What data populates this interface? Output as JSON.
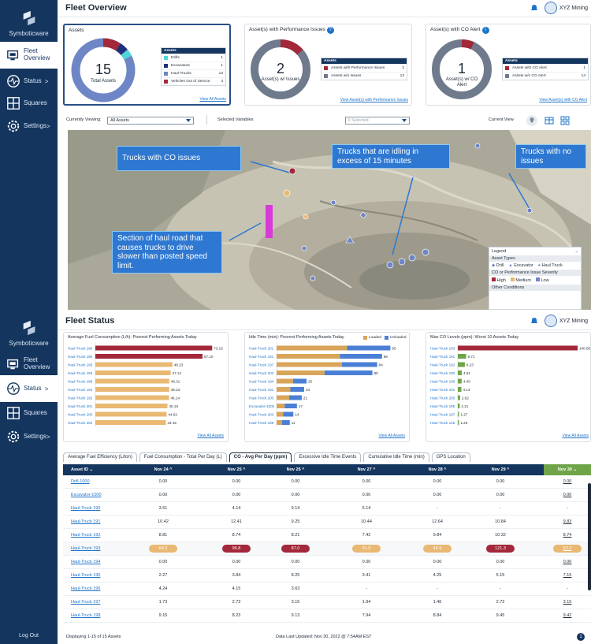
{
  "top": {
    "brand": "Symboticware",
    "page_title": "Fleet Overview",
    "user_name": "XYZ Mining",
    "nav": [
      {
        "label": "Fleet Overview"
      },
      {
        "label": "Status",
        "arrow": ">"
      },
      {
        "label": "Squares"
      },
      {
        "label": "Settings",
        "arrow": ">"
      }
    ],
    "assets_card": {
      "title": "Assets",
      "donut_value": "15",
      "donut_label": "Total Assets",
      "legend_header": "Assets",
      "legend": [
        {
          "label": "Drills",
          "count": "1",
          "color": "#4fd6d6"
        },
        {
          "label": "Excavators",
          "count": "1",
          "color": "#1f2f7a"
        },
        {
          "label": "Haul-Trucks",
          "count": "13",
          "color": "#6f86c6"
        },
        {
          "label": "Vehicles Out of Service",
          "count": "3",
          "color": "#a3283a"
        }
      ],
      "link": "View All Assets"
    },
    "perf_card": {
      "title": "Asset(s) with Performance Issues",
      "donut_value": "2",
      "donut_label": "Asset(s) w/ Issues",
      "legend_header": "Assets",
      "legend": [
        {
          "label": "Assets with Performance Issues",
          "count": "2",
          "color": "#a3283a"
        },
        {
          "label": "Assets w/o Issues",
          "count": "13",
          "color": "#6f7b8c"
        }
      ],
      "link": "View Asset(s) with Performance Issues"
    },
    "co_card": {
      "title": "Asset(s) with CO Alert",
      "donut_value": "1",
      "donut_label": "Asset(s) w/ CO Alert",
      "legend_header": "Assets",
      "legend": [
        {
          "label": "Assets with CO Alert",
          "count": "1",
          "color": "#a3283a"
        },
        {
          "label": "Assets w/o CO Alert",
          "count": "14",
          "color": "#6f7b8c"
        }
      ],
      "link": "View Asset(s) with CO Alert"
    },
    "filters": {
      "viewing_label": "Currently Viewing:",
      "viewing_value": "All Assets",
      "variables_label": "Selected Variables",
      "variables_value": "0 Selected",
      "view_label": "Current View"
    },
    "map": {
      "callouts": [
        "Trucks with CO issues",
        "Trucks that are idling in excess of 15 minutes",
        "Trucks with no issues",
        "Section of haul road that causes trucks to drive slower than posted speed limit."
      ],
      "legend": {
        "title": "Legend",
        "asset_types_label": "Asset Types",
        "types": [
          "Drill",
          "Excavator",
          "Haul Truck"
        ],
        "severity_label": "CO or Performance Issue Severity",
        "severities": [
          {
            "label": "High",
            "color": "#a3283a"
          },
          {
            "label": "Medium",
            "color": "#e9b872"
          },
          {
            "label": "Low",
            "color": "#6f86c6"
          }
        ],
        "other_label": "Other Conditions"
      }
    }
  },
  "bottom": {
    "brand": "Symboticware",
    "page_title": "Fleet Status",
    "user_name": "XYZ Mining",
    "nav": [
      {
        "label": "Fleet Overview"
      },
      {
        "label": "Status",
        "arrow": ">"
      },
      {
        "label": "Squares"
      },
      {
        "label": "Settings",
        "arrow": ">"
      }
    ],
    "logout": "Log Out",
    "view_all": "View All Assets",
    "footer_left": "Displaying 1-15 of 15 Assets",
    "footer_center": "Data Last Updated: Nov 30, 2022 @ 7:54AM EST",
    "tabs": [
      "Average Fuel Efficiency (L/ton)",
      "Fuel Consumption - Total Per Day (L)",
      "CO - Avg Per Day (ppm)",
      "Excessive Idle Time Events",
      "Cumulative Idle Time (min)",
      "GPS Location"
    ],
    "table": {
      "columns": [
        "Asset ID",
        "Nov 24",
        "Nov 25",
        "Nov 26",
        "Nov 27",
        "Nov 28",
        "Nov 29",
        "Nov 30"
      ],
      "rows": [
        {
          "id": "Drill-1000",
          "vals": [
            "0.00",
            "0.00",
            "0.00",
            "0.00",
            "0.00",
            "0.00",
            "0.00"
          ]
        },
        {
          "id": "Excavator-1000",
          "vals": [
            "0.00",
            "0.00",
            "0.00",
            "0.00",
            "0.00",
            "0.00",
            "0.00"
          ]
        },
        {
          "id": "Haul-Truck 190",
          "vals": [
            "3.51",
            "4.14",
            "9.14",
            "5.14",
            "-",
            "-",
            "-"
          ]
        },
        {
          "id": "Haul-Truck 191",
          "vals": [
            "10.42",
            "12.41",
            "9.25",
            "10.44",
            "12.64",
            "10.84",
            "9.83"
          ]
        },
        {
          "id": "Haul-Truck 192",
          "vals": [
            "8.81",
            "8.74",
            "8.21",
            "7.42",
            "9.84",
            "10.32",
            "8.74"
          ]
        },
        {
          "id": "Haul-Truck 193",
          "vals": [
            "64.2",
            "96.8",
            "87.0",
            "51.9",
            "45.9",
            "121.3",
            "53.2"
          ]
        },
        {
          "id": "Haul-Truck 194",
          "vals": [
            "0.00",
            "0.00",
            "0.00",
            "0.00",
            "0.00",
            "0.00",
            "0.00"
          ]
        },
        {
          "id": "Haul-Truck 195",
          "vals": [
            "2.27",
            "3.84",
            "8.25",
            "3.41",
            "4.25",
            "5.15",
            "7.15"
          ]
        },
        {
          "id": "Haul-Truck 196",
          "vals": [
            "4.24",
            "4.15",
            "3.63",
            "-",
            "-",
            "-",
            "-"
          ]
        },
        {
          "id": "Haul-Truck 197",
          "vals": [
            "1.73",
            "2.73",
            "3.15",
            "1.94",
            "1.46",
            "2.72",
            "3.15"
          ]
        },
        {
          "id": "Haul-Truck 198",
          "vals": [
            "9.15",
            "8.23",
            "9.13",
            "7.94",
            "8.84",
            "9.45",
            "9.42"
          ]
        }
      ],
      "highlight_colors": [
        "#e9b872",
        "#a3283a",
        "#a3283a",
        "#e9b872",
        "#e9b872",
        "#a3283a",
        "#e9b872"
      ]
    }
  },
  "chart_data": [
    {
      "type": "bar",
      "title": "Average Fuel Consumption (L/h): Poorest Performing Assets Today",
      "categories": [
        "Haul-Truck 196",
        "Haul-Truck 190",
        "Haul-Truck 195",
        "Haul-Truck 193",
        "Haul-Truck 198",
        "Haul-Truck 194",
        "Haul-Truck 192",
        "Haul-Truck 201",
        "Haul-Truck 200",
        "Haul-Truck 202"
      ],
      "values": [
        73.15,
        67.1,
        48.23,
        47.14,
        46.31,
        46.23,
        46.14,
        45.15,
        44.62,
        44.15
      ],
      "xlim": [
        0,
        75
      ],
      "colors": [
        "#a3283a",
        "#a3283a",
        "#e9b872",
        "#e9b872",
        "#e9b872",
        "#e9b872",
        "#e9b872",
        "#e9b872",
        "#e9b872",
        "#e9b872"
      ]
    },
    {
      "type": "bar",
      "title": "Idle Time (min): Poorest Performing Assets Today",
      "legend": [
        "Loaded",
        "Unloaded"
      ],
      "legend_colors": [
        "#d9a55b",
        "#4a7fd6"
      ],
      "categories": [
        "Haul-Truck 201",
        "Haul-Truck 191",
        "Haul-Truck 197",
        "Haul-Truck 202",
        "Haul-Truck 194",
        "Haul-Truck 191",
        "Haul-Truck 200",
        "Excavator-1000",
        "Haul-Truck 202",
        "Haul-Truck 199"
      ],
      "values": [
        95,
        88,
        84,
        80,
        25,
        23,
        21,
        17,
        14,
        11
      ],
      "loaded_fraction": [
        0.62,
        0.6,
        0.65,
        0.5,
        0.55,
        0.5,
        0.5,
        0.4,
        0.4,
        0.4
      ],
      "xlim": [
        0,
        100
      ]
    },
    {
      "type": "bar",
      "title": "Max CO Levels (ppm): Worst 10 Assets Today",
      "categories": [
        "Haul-Truck 193",
        "Haul-Truck 191",
        "Haul-Truck 192",
        "Haul-Truck 190",
        "Haul-Truck 196",
        "Haul-Truck 201",
        "Haul-Truck 200",
        "Haul-Truck 195",
        "Haul-Truck 197",
        "Haul-Truck 125"
      ],
      "values": [
        140.0,
        9.71,
        8.23,
        4.61,
        4.45,
        4.13,
        2.62,
        2.21,
        1.27,
        1.25
      ],
      "xlim": [
        0,
        140
      ],
      "colors": [
        "#a3283a",
        "#6fa548",
        "#6fa548",
        "#6fa548",
        "#6fa548",
        "#6fa548",
        "#6fa548",
        "#6fa548",
        "#6fa548",
        "#6fa548"
      ]
    }
  ]
}
